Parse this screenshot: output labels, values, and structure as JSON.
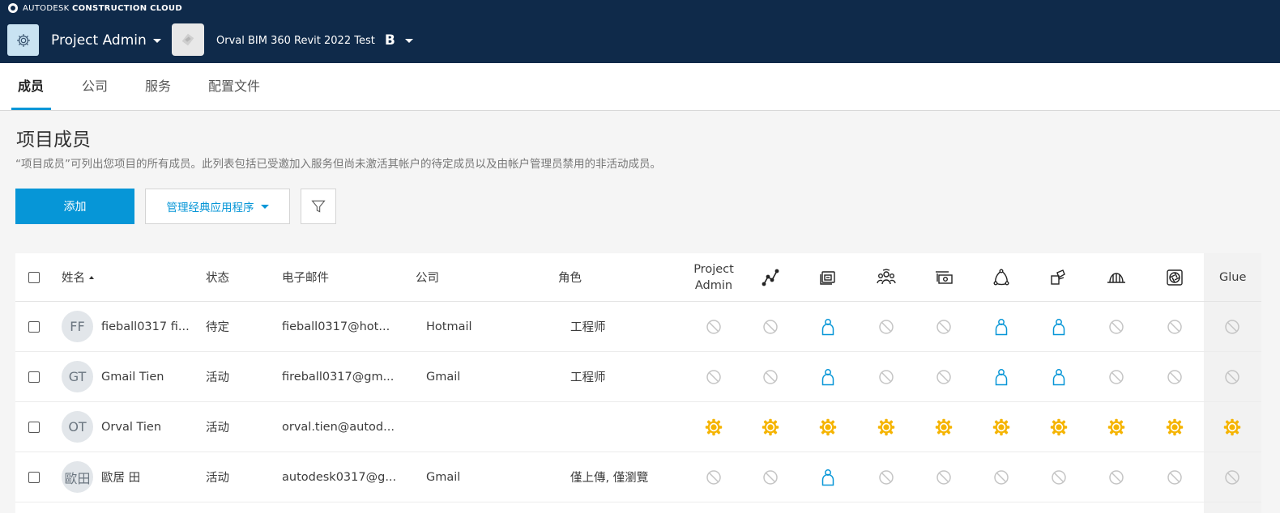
{
  "header": {
    "brand_light": "AUTODESK",
    "brand_bold": "CONSTRUCTION CLOUD",
    "module": "Project Admin",
    "project": "Orval BIM 360 Revit 2022 Test",
    "hub_mark": "B"
  },
  "tabs": [
    {
      "label": "成员",
      "active": true
    },
    {
      "label": "公司",
      "active": false
    },
    {
      "label": "服务",
      "active": false
    },
    {
      "label": "配置文件",
      "active": false
    }
  ],
  "page": {
    "title": "项目成员",
    "description": "“项目成员”可列出您项目的所有成员。此列表包括已受邀加入服务但尚未激活其帐户的待定成员以及由帐户管理员禁用的非活动成员。"
  },
  "actions": {
    "add": "添加",
    "manage_classic": "管理经典应用程序"
  },
  "table": {
    "headers": {
      "name": "姓名",
      "status": "状态",
      "email": "电子邮件",
      "company": "公司",
      "role": "角色",
      "project_admin_1": "Project",
      "project_admin_2": "Admin",
      "glue": "Glue"
    },
    "service_icons": [
      "line-graph-icon",
      "document-management-icon",
      "team-icon",
      "cost-icon",
      "triangle-nodes-icon",
      "design-collaboration-icon",
      "hard-hat-icon",
      "camera-shutter-icon"
    ],
    "rows": [
      {
        "initials": "FF",
        "name": "fieball0317 fi...",
        "status": "待定",
        "email": "fieball0317@hot...",
        "company": "Hotmail",
        "role": "工程师",
        "access": [
          "none",
          "none",
          "user",
          "none",
          "none",
          "user",
          "user",
          "none",
          "none",
          "none"
        ]
      },
      {
        "initials": "GT",
        "name": "Gmail Tien",
        "status": "活动",
        "email": "fireball0317@gm...",
        "company": "Gmail",
        "role": "工程师",
        "access": [
          "none",
          "none",
          "user",
          "none",
          "none",
          "user",
          "user",
          "none",
          "none",
          "none"
        ]
      },
      {
        "initials": "OT",
        "name": "Orval Tien",
        "status": "活动",
        "email": "orval.tien@autod...",
        "company": "",
        "role": "",
        "access": [
          "admin",
          "admin",
          "admin",
          "admin",
          "admin",
          "admin",
          "admin",
          "admin",
          "admin",
          "admin"
        ]
      },
      {
        "initials": "歐田",
        "name": "歐居 田",
        "status": "活动",
        "email": "autodesk0317@g...",
        "company": "Gmail",
        "role": "僅上傳, 僅瀏覽",
        "access": [
          "none",
          "none",
          "user",
          "none",
          "none",
          "none",
          "none",
          "none",
          "none",
          "none"
        ]
      }
    ]
  },
  "colors": {
    "header_bg": "#0f2a4a",
    "accent": "#0696d7",
    "admin_gear": "#f5b400",
    "none_icon": "#c4c4c4"
  }
}
